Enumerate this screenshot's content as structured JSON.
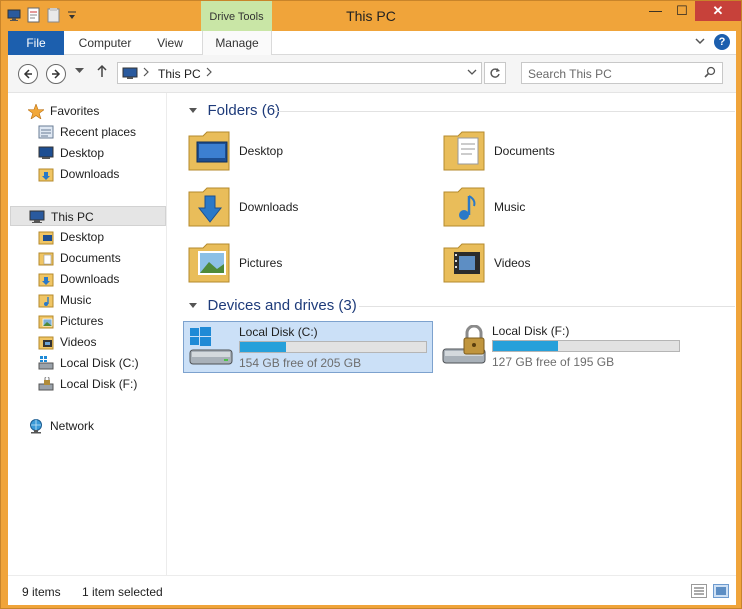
{
  "window": {
    "title": "This PC",
    "context_tab": "Drive Tools",
    "close_glyph": "✕",
    "min_glyph": "—",
    "max_glyph": "☐"
  },
  "ribbon": {
    "tabs": [
      "File",
      "Computer",
      "View",
      "Manage"
    ],
    "help": "?"
  },
  "navigation": {
    "address_crumb": "This PC",
    "search_placeholder": "Search This PC"
  },
  "sidebar": {
    "favorites": {
      "label": "Favorites",
      "items": [
        "Recent places",
        "Desktop",
        "Downloads"
      ]
    },
    "this_pc": {
      "label": "This PC",
      "items": [
        "Desktop",
        "Documents",
        "Downloads",
        "Music",
        "Pictures",
        "Videos",
        "Local Disk (C:)",
        "Local Disk (F:)"
      ]
    },
    "network": {
      "label": "Network"
    }
  },
  "content": {
    "folders_header": "Folders (6)",
    "folders": [
      "Desktop",
      "Documents",
      "Downloads",
      "Music",
      "Pictures",
      "Videos"
    ],
    "drives_header": "Devices and drives (3)",
    "drives": [
      {
        "name": "Local Disk (C:)",
        "free_text": "154 GB free of 205 GB",
        "used_fraction": 0.249,
        "selected": true,
        "icon": "windows-drive-icon"
      },
      {
        "name": "Local Disk (F:)",
        "free_text": "127 GB free of 195 GB",
        "used_fraction": 0.349,
        "selected": false,
        "icon": "locked-drive-icon"
      }
    ]
  },
  "status": {
    "item_count": "9 items",
    "selection": "1 item selected"
  },
  "colors": {
    "title_bar": "#f0a43a",
    "file_tab": "#1c5fae",
    "context_tab": "#c9e6a6",
    "close_button": "#c7413a",
    "section_header": "#1e3b7a",
    "usage_bar": "#26a0da",
    "selection": "#cbe0f7"
  }
}
